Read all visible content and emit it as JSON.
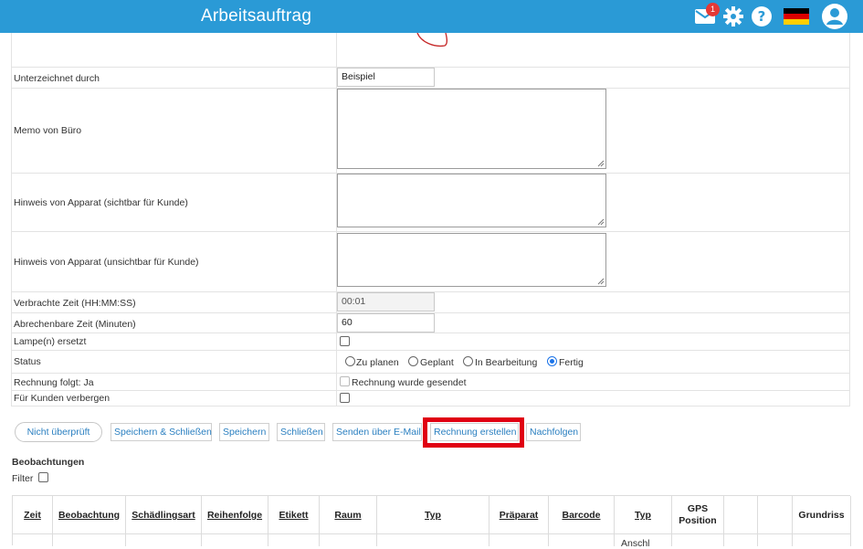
{
  "header": {
    "title": "Arbeitsauftrag",
    "mail_badge": "1"
  },
  "form": {
    "signed_by_label": "Unterzeichnet durch",
    "signed_by_value": "Beispiel",
    "memo_label": "Memo von Büro",
    "note_visible_label": "Hinweis von Apparat (sichtbar für Kunde)",
    "note_hidden_label": "Hinweis von Apparat (unsichtbar für Kunde)",
    "time_spent_label": "Verbrachte Zeit (HH:MM:SS)",
    "time_spent_value": "00:01",
    "billable_label": "Abrechenbare Zeit (Minuten)",
    "billable_value": "60",
    "lamp_label": "Lampe(n) ersetzt",
    "status_label": "Status",
    "status_options": [
      "Zu planen",
      "Geplant",
      "In Bearbeitung",
      "Fertig"
    ],
    "status_selected": "Fertig",
    "invoice_follows_label": "Rechnung folgt: Ja",
    "invoice_sent_label": "Rechnung wurde gesendet",
    "hide_customer_label": "Für Kunden verbergen"
  },
  "actions": {
    "not_checked": "Nicht überprüft",
    "save_close": "Speichern & Schließen",
    "save": "Speichern",
    "close": "Schließen",
    "send_email": "Senden über E-Mail",
    "create_invoice": "Rechnung erstellen",
    "follow_up": "Nachfolgen"
  },
  "observations": {
    "title": "Beobachtungen",
    "filter_label": "Filter",
    "columns": [
      "Zeit",
      "Beobachtung",
      "Schädlingsart",
      "Reihenfolge",
      "Etikett",
      "Raum",
      "Typ",
      "Präparat",
      "Barcode",
      "Typ",
      "GPS Position",
      "",
      "",
      "Grundriss"
    ],
    "gps_line1": "GPS",
    "gps_line2": "Position",
    "first_row_peek": "Anschl"
  },
  "colors": {
    "header_bg": "#2a9ad6",
    "link": "#2a7fc0",
    "highlight": "#e00012"
  }
}
